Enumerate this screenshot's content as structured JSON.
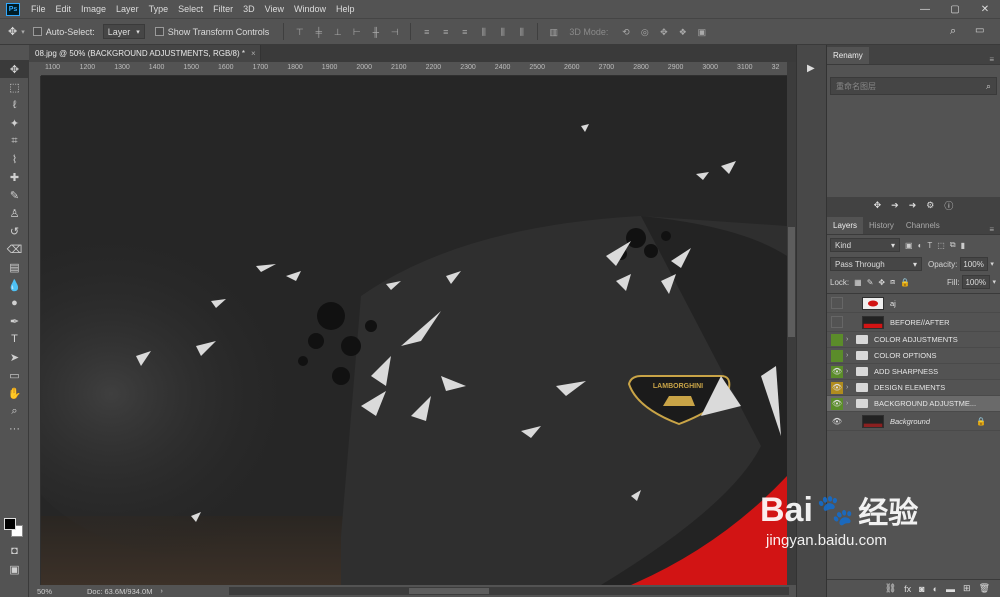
{
  "app": {
    "logo": "Ps"
  },
  "menu": [
    "File",
    "Edit",
    "Image",
    "Layer",
    "Type",
    "Select",
    "Filter",
    "3D",
    "View",
    "Window",
    "Help"
  ],
  "window_controls": {
    "minimize": "—",
    "maximize": "▢",
    "close": "✕"
  },
  "options_bar": {
    "auto_select_label": "Auto-Select:",
    "auto_select_value": "Layer",
    "show_transform_label": "Show Transform Controls",
    "three_d_mode_label": "3D Mode:"
  },
  "document": {
    "tab_title": "08.jpg @ 50% (BACKGROUND ADJUSTMENTS, RGB/8) *",
    "close": "×"
  },
  "ruler": {
    "top_labels": [
      "1100",
      "1200",
      "1300",
      "1400",
      "1500",
      "1600",
      "1700",
      "1800",
      "1900",
      "2000",
      "2100",
      "2200",
      "2300",
      "2400",
      "2500",
      "2600",
      "2700",
      "2800",
      "2900",
      "3000",
      "3100",
      "32"
    ]
  },
  "status": {
    "zoom": "50%",
    "doc_info": "Doc: 63.6M/934.0M"
  },
  "canvas_text": {
    "badge": "LAMBORGHINI"
  },
  "renamy": {
    "tab": "Renamy",
    "search_placeholder": "重命名图层"
  },
  "layers_panel": {
    "tabs": [
      "Layers",
      "History",
      "Channels"
    ],
    "filter_kind": "Kind",
    "blend_mode": "Pass Through",
    "opacity_label": "Opacity:",
    "opacity_value": "100%",
    "lock_label": "Lock:",
    "fill_label": "Fill:",
    "fill_value": "100%",
    "layers": [
      {
        "name": "aj",
        "type": "image",
        "visible": false
      },
      {
        "name": "BEFORE//AFTER",
        "type": "image",
        "visible": false
      },
      {
        "name": "COLOR ADJUSTMENTS",
        "type": "group",
        "vis_color": "#5b8c2a",
        "visible": false
      },
      {
        "name": "COLOR OPTIONS",
        "type": "group",
        "vis_color": "#5b8c2a",
        "visible": false
      },
      {
        "name": "ADD SHARPNESS",
        "type": "group",
        "vis_color": "#5b8c2a",
        "visible": true
      },
      {
        "name": "DESIGN ELEMENTS",
        "type": "group",
        "vis_color": "#b08c1e",
        "visible": true
      },
      {
        "name": "BACKGROUND ADJUSTME...",
        "type": "group",
        "vis_color": "#5b8c2a",
        "visible": true,
        "selected": true
      },
      {
        "name": "Background",
        "type": "image",
        "visible": true,
        "locked": true
      }
    ]
  },
  "watermark": {
    "brand": "Bai",
    "brand2": "经验",
    "url": "jingyan.baidu.com"
  },
  "colors": {
    "panel": "#535353",
    "dark": "#3a3a3a",
    "accent_red": "#d21414",
    "gold": "#c9a447"
  }
}
